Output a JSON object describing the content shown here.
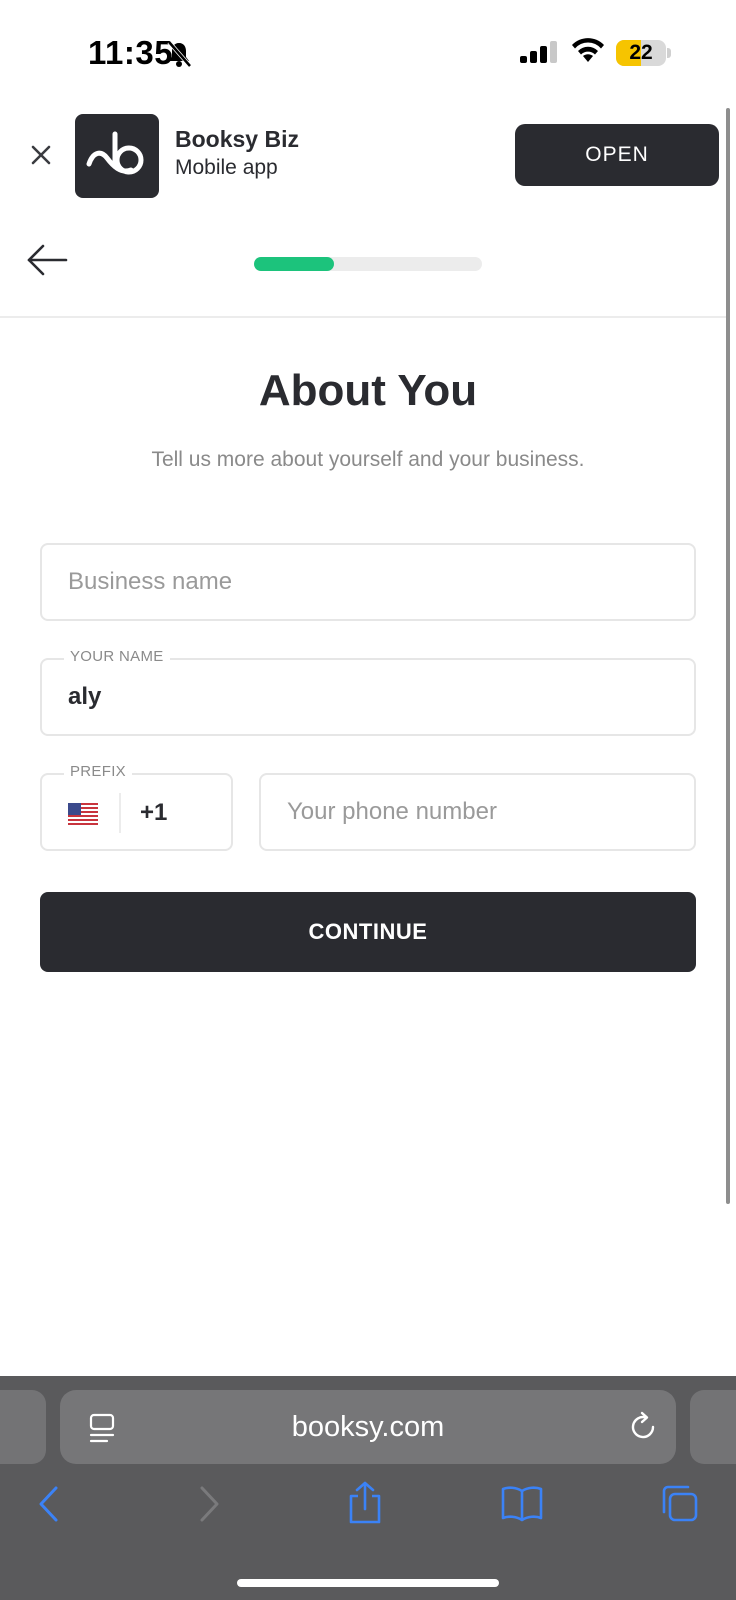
{
  "status_bar": {
    "time": "11:35",
    "battery_level": "22",
    "battery_fraction": 0.5
  },
  "app_banner": {
    "app_name": "Booksy Biz",
    "app_subtitle": "Mobile app",
    "open_label": "OPEN"
  },
  "progress": {
    "fraction": 0.35,
    "fill_color": "#1cc37c"
  },
  "form": {
    "title": "About You",
    "subtitle": "Tell us more about yourself and your business.",
    "business_name": {
      "placeholder": "Business name",
      "value": ""
    },
    "your_name": {
      "label": "YOUR NAME",
      "value": "aly"
    },
    "prefix": {
      "label": "PREFIX",
      "value": "+1",
      "flag": "us-flag-icon"
    },
    "phone": {
      "placeholder": "Your phone number",
      "value": ""
    },
    "continue_label": "CONTINUE"
  },
  "browser": {
    "url": "booksy.com",
    "accent_color": "#3b82f6"
  },
  "colors": {
    "primary_dark": "#2a2b30",
    "accent_green": "#1cc37c"
  }
}
